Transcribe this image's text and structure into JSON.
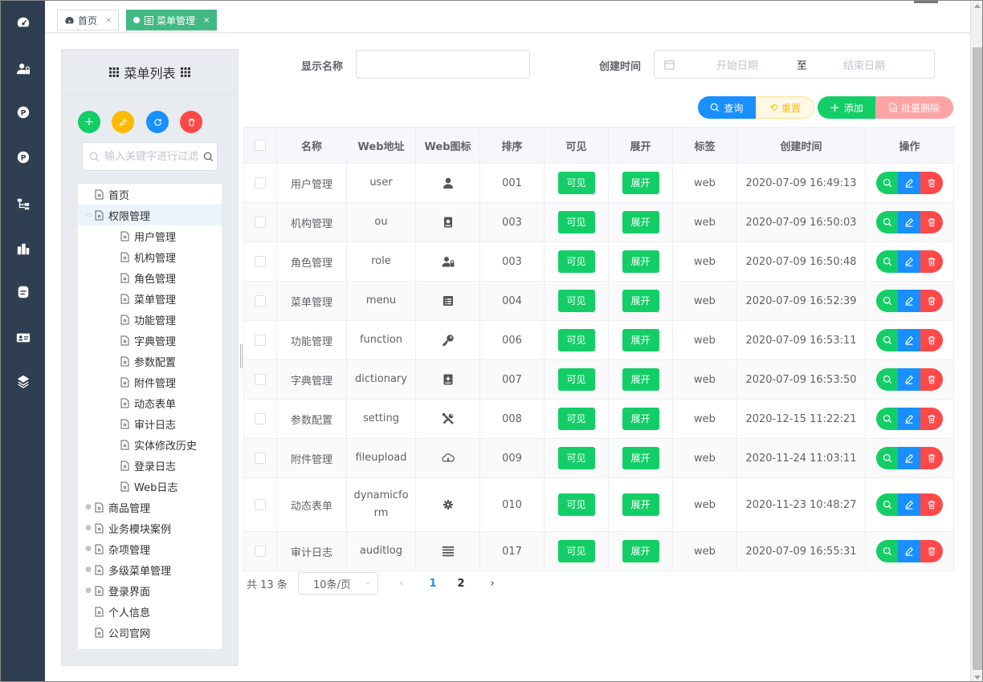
{
  "sidebar": {
    "icons": [
      "dashboard-icon",
      "user-lock-icon",
      "parking-icon",
      "parking-icon-2",
      "sitemap-icon",
      "building-icon",
      "blog-icon",
      "id-card-icon",
      "layers-icon"
    ]
  },
  "tabs": [
    {
      "label": "首页",
      "active": false
    },
    {
      "label": "菜单管理",
      "active": true
    }
  ],
  "tree": {
    "title": "菜单列表",
    "search_placeholder": "输入关键字进行过滤",
    "nodes": [
      {
        "label": "首页",
        "level": 0,
        "expander": false
      },
      {
        "label": "权限管理",
        "level": 0,
        "expander": true,
        "expanded": true
      },
      {
        "label": "用户管理",
        "level": 1
      },
      {
        "label": "机构管理",
        "level": 1
      },
      {
        "label": "角色管理",
        "level": 1
      },
      {
        "label": "菜单管理",
        "level": 1
      },
      {
        "label": "功能管理",
        "level": 1
      },
      {
        "label": "字典管理",
        "level": 1
      },
      {
        "label": "参数配置",
        "level": 1
      },
      {
        "label": "附件管理",
        "level": 1
      },
      {
        "label": "动态表单",
        "level": 1
      },
      {
        "label": "审计日志",
        "level": 1
      },
      {
        "label": "实体修改历史",
        "level": 1
      },
      {
        "label": "登录日志",
        "level": 1
      },
      {
        "label": "Web日志",
        "level": 1
      },
      {
        "label": "商品管理",
        "level": 0,
        "expander": true
      },
      {
        "label": "业务模块案例",
        "level": 0,
        "expander": true
      },
      {
        "label": "杂项管理",
        "level": 0,
        "expander": true
      },
      {
        "label": "多级菜单管理",
        "level": 0,
        "expander": true
      },
      {
        "label": "登录界面",
        "level": 0,
        "expander": true
      },
      {
        "label": "个人信息",
        "level": 0,
        "expander": false
      },
      {
        "label": "公司官网",
        "level": 0,
        "expander": false
      }
    ]
  },
  "form": {
    "name_label": "显示名称",
    "name_value": "",
    "time_label": "创建时间",
    "start_placeholder": "开始日期",
    "range_sep": "至",
    "end_placeholder": "结束日期"
  },
  "toolbar": {
    "query": "查询",
    "reset": "重置",
    "add": "添加",
    "batch_delete": "批量删除"
  },
  "table": {
    "headers": [
      "名称",
      "Web地址",
      "Web图标",
      "排序",
      "可见",
      "展开",
      "标签",
      "创建时间",
      "操作"
    ],
    "rows": [
      {
        "name": "用户管理",
        "url": "user",
        "icon": "user-icon",
        "order": "001",
        "visible": "可见",
        "expand": "展开",
        "tag": "web",
        "time": "2020-07-09 16:49:13"
      },
      {
        "name": "机构管理",
        "url": "ou",
        "icon": "book-icon",
        "order": "003",
        "visible": "可见",
        "expand": "展开",
        "tag": "web",
        "time": "2020-07-09 16:50:03"
      },
      {
        "name": "角色管理",
        "url": "role",
        "icon": "user-lock-icon",
        "order": "003",
        "visible": "可见",
        "expand": "展开",
        "tag": "web",
        "time": "2020-07-09 16:50:48"
      },
      {
        "name": "菜单管理",
        "url": "menu",
        "icon": "list-box-icon",
        "order": "004",
        "visible": "可见",
        "expand": "展开",
        "tag": "web",
        "time": "2020-07-09 16:52:39"
      },
      {
        "name": "功能管理",
        "url": "function",
        "icon": "key-icon",
        "order": "006",
        "visible": "可见",
        "expand": "展开",
        "tag": "web",
        "time": "2020-07-09 16:53:11"
      },
      {
        "name": "字典管理",
        "url": "dictionary",
        "icon": "dictionary-icon",
        "order": "007",
        "visible": "可见",
        "expand": "展开",
        "tag": "web",
        "time": "2020-07-09 16:53:50"
      },
      {
        "name": "参数配置",
        "url": "setting",
        "icon": "tools-icon",
        "order": "008",
        "visible": "可见",
        "expand": "展开",
        "tag": "web",
        "time": "2020-12-15 11:22:21"
      },
      {
        "name": "附件管理",
        "url": "fileupload",
        "icon": "cloud-icon",
        "order": "009",
        "visible": "可见",
        "expand": "展开",
        "tag": "web",
        "time": "2020-11-24 11:03:11"
      },
      {
        "name": "动态表单",
        "url": "dynamicform",
        "icon": "cog-icon",
        "order": "010",
        "visible": "可见",
        "expand": "展开",
        "tag": "web",
        "time": "2020-11-23 10:48:27"
      },
      {
        "name": "审计日志",
        "url": "auditlog",
        "icon": "align-justify-icon",
        "order": "017",
        "visible": "可见",
        "expand": "展开",
        "tag": "web",
        "time": "2020-07-09 16:55:31"
      }
    ]
  },
  "pagination": {
    "total": "共 13 条",
    "page_size": "10条/页",
    "pages": [
      "1",
      "2"
    ],
    "current": "1"
  },
  "colors": {
    "sidebar": "#2f3e51",
    "tab_active": "#42b983",
    "green": "#13ce66",
    "blue": "#1890ff",
    "red": "#ff4949",
    "orange": "#ffba00"
  }
}
